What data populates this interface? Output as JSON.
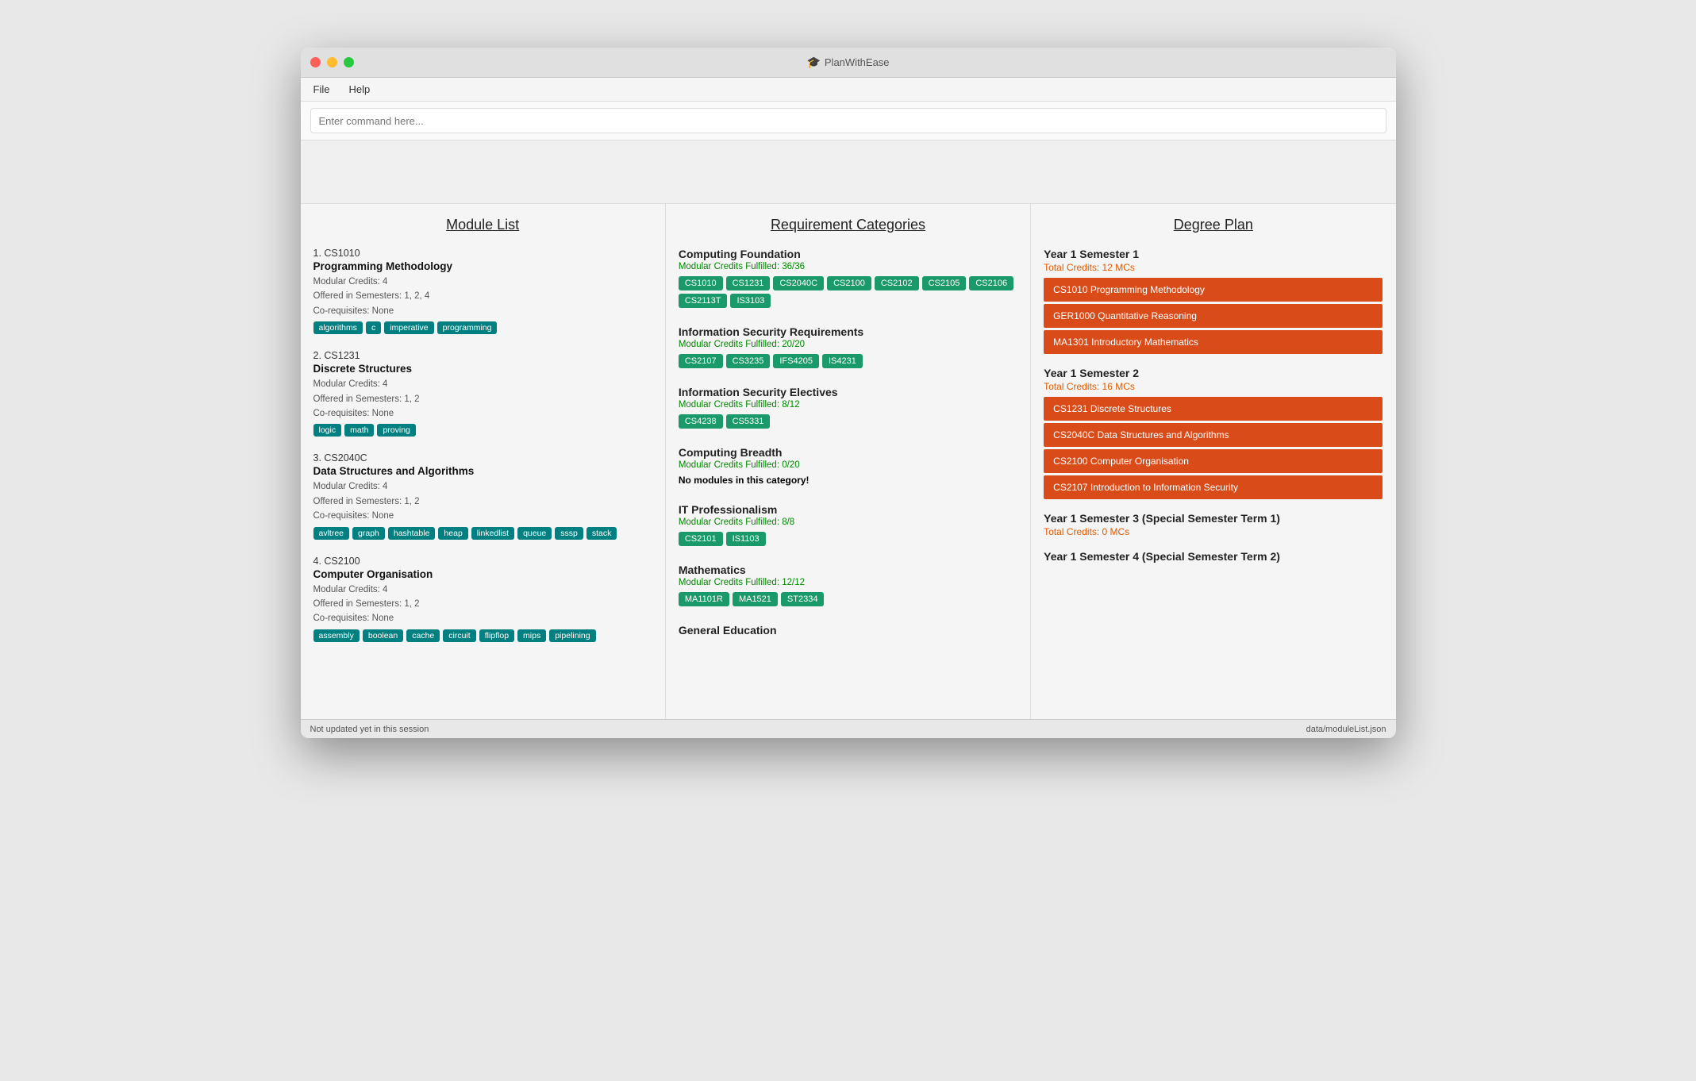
{
  "window": {
    "title": "PlanWithEase",
    "title_icon": "🎓"
  },
  "menu": {
    "items": [
      "File",
      "Help"
    ]
  },
  "command": {
    "placeholder": "Enter command here..."
  },
  "columns": {
    "module_list": {
      "header": "Module List",
      "modules": [
        {
          "number": "1.",
          "code": "CS1010",
          "name": "Programming Methodology",
          "credits": "Modular Credits: 4",
          "semesters": "Offered in Semesters: 1, 2, 4",
          "coreqs": "Co-requisites: None",
          "tags": [
            "algorithms",
            "c",
            "imperative",
            "programming"
          ]
        },
        {
          "number": "2.",
          "code": "CS1231",
          "name": "Discrete Structures",
          "credits": "Modular Credits: 4",
          "semesters": "Offered in Semesters: 1, 2",
          "coreqs": "Co-requisites: None",
          "tags": [
            "logic",
            "math",
            "proving"
          ]
        },
        {
          "number": "3.",
          "code": "CS2040C",
          "name": "Data Structures and Algorithms",
          "credits": "Modular Credits: 4",
          "semesters": "Offered in Semesters: 1, 2",
          "coreqs": "Co-requisites: None",
          "tags": [
            "avltree",
            "graph",
            "hashtable",
            "heap",
            "linkedlist",
            "queue",
            "sssp",
            "stack"
          ]
        },
        {
          "number": "4.",
          "code": "CS2100",
          "name": "Computer Organisation",
          "credits": "Modular Credits: 4",
          "semesters": "Offered in Semesters: 1, 2",
          "coreqs": "Co-requisites: None",
          "tags": [
            "assembly",
            "boolean",
            "cache",
            "circuit",
            "flipflop",
            "mips",
            "pipelining"
          ]
        }
      ]
    },
    "requirements": {
      "header": "Requirement Categories",
      "categories": [
        {
          "title": "Computing Foundation",
          "credits_text": "Modular Credits Fulfilled: 36/36",
          "credits_type": "full",
          "modules": [
            "CS1010",
            "CS1231",
            "CS2040C",
            "CS2100",
            "CS2102",
            "CS2105",
            "CS2106",
            "CS2113T",
            "IS3103"
          ]
        },
        {
          "title": "Information Security Requirements",
          "credits_text": "Modular Credits Fulfilled: 20/20",
          "credits_type": "full",
          "modules": [
            "CS2107",
            "CS3235",
            "IFS4205",
            "IS4231"
          ]
        },
        {
          "title": "Information Security Electives",
          "credits_text": "Modular Credits Fulfilled: 8/12",
          "credits_type": "partial",
          "modules": [
            "CS4238",
            "CS5331"
          ]
        },
        {
          "title": "Computing Breadth",
          "credits_text": "Modular Credits Fulfilled: 0/20",
          "credits_type": "partial",
          "modules": [],
          "none_text": "No modules in this category!"
        },
        {
          "title": "IT Professionalism",
          "credits_text": "Modular Credits Fulfilled: 8/8",
          "credits_type": "full",
          "modules": [
            "CS2101",
            "IS1103"
          ]
        },
        {
          "title": "Mathematics",
          "credits_text": "Modular Credits Fulfilled: 12/12",
          "credits_type": "full",
          "modules": [
            "MA1101R",
            "MA1521",
            "ST2334"
          ]
        },
        {
          "title": "General Education",
          "credits_text": "",
          "credits_type": "partial",
          "modules": []
        }
      ]
    },
    "degree_plan": {
      "header": "Degree Plan",
      "semesters": [
        {
          "title": "Year 1 Semester 1",
          "credits": "Total Credits: 12 MCs",
          "modules": [
            "CS1010 Programming Methodology",
            "GER1000 Quantitative Reasoning",
            "MA1301 Introductory Mathematics"
          ]
        },
        {
          "title": "Year 1 Semester 2",
          "credits": "Total Credits: 16 MCs",
          "modules": [
            "CS1231 Discrete Structures",
            "CS2040C Data Structures and Algorithms",
            "CS2100 Computer Organisation",
            "CS2107 Introduction to Information Security"
          ]
        },
        {
          "title": "Year 1 Semester 3 (Special Semester Term 1)",
          "credits": "Total Credits: 0 MCs",
          "modules": []
        },
        {
          "title": "Year 1 Semester 4 (Special Semester Term 2)",
          "credits": "",
          "modules": []
        }
      ]
    }
  },
  "statusbar": {
    "left": "Not updated yet in this session",
    "right": "data/moduleList.json"
  }
}
